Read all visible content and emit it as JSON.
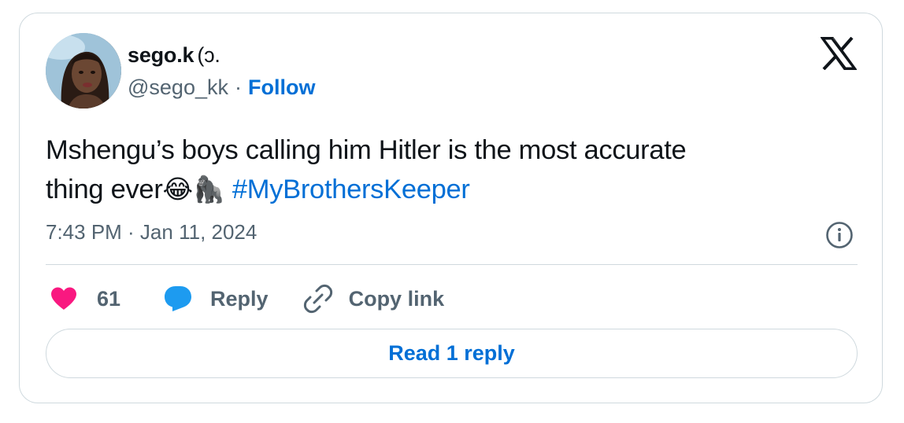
{
  "user": {
    "display_name": "sego.k",
    "name_symbol": "(ɔ.",
    "handle": "@sego_kk",
    "separator": "·",
    "follow_label": "Follow",
    "avatar_icon": "profile-photo"
  },
  "brand": {
    "logo_icon": "x-logo"
  },
  "tweet": {
    "text_line1": "Mshengu’s boys calling him Hitler is the most accurate",
    "text_line2": "thing ever",
    "emoji_1": "😂",
    "emoji_2": "🦍",
    "hashtag": "#MyBrothersKeeper",
    "timestamp": "7:43 PM · Jan 11, 2024",
    "info_icon": "info-icon"
  },
  "actions": {
    "like_count": "61",
    "reply_label": "Reply",
    "copy_link_label": "Copy link"
  },
  "footer": {
    "read_replies_label": "Read 1 reply"
  },
  "colors": {
    "link_blue": "#006fd6",
    "like_pink": "#f91880",
    "reply_blue": "#1d9bf0",
    "muted_gray": "#536471",
    "border": "#cfd9de"
  }
}
